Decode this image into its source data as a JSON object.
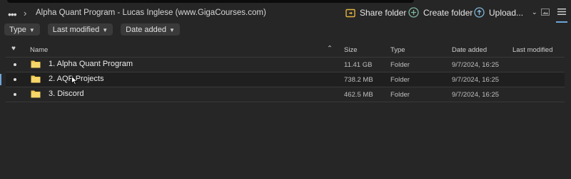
{
  "header": {
    "more_icon": "ellipsis-icon",
    "breadcrumb": "Alpha Quant Program - Lucas Inglese (www.GigaCourses.com)",
    "actions": {
      "share": "Share folder",
      "create": "Create folder",
      "upload": "Upload..."
    }
  },
  "filters": [
    "Type",
    "Last modified",
    "Date added"
  ],
  "table": {
    "columns": {
      "name": "Name",
      "size": "Size",
      "type": "Type",
      "date_added": "Date added",
      "last_modified": "Last modified"
    },
    "rows": [
      {
        "name": "1. Alpha Quant Program",
        "size": "11.41 GB",
        "type": "Folder",
        "date_added": "9/7/2024, 16:25",
        "last_modified": ""
      },
      {
        "name": "2. AQP Projects",
        "size": "738.2 MB",
        "type": "Folder",
        "date_added": "9/7/2024, 16:25",
        "last_modified": ""
      },
      {
        "name": "3. Discord",
        "size": "462.5 MB",
        "type": "Folder",
        "date_added": "9/7/2024, 16:25",
        "last_modified": ""
      }
    ]
  },
  "colors": {
    "background": "#262626",
    "folder": "#f2c94c",
    "share_icon": "#e3b341",
    "create_icon": "#7fb6a0",
    "upload_icon": "#7fb6d8"
  }
}
